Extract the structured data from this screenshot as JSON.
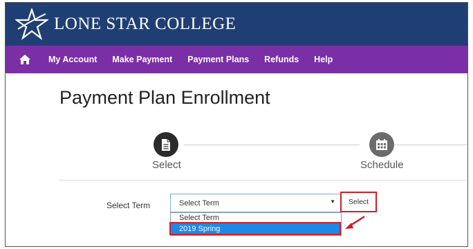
{
  "brand": {
    "name": "LONE STAR COLLEGE"
  },
  "nav": {
    "home_icon": "home-icon",
    "items": [
      {
        "label": "My Account"
      },
      {
        "label": "Make Payment"
      },
      {
        "label": "Payment Plans"
      },
      {
        "label": "Refunds"
      },
      {
        "label": "Help"
      }
    ]
  },
  "page": {
    "title": "Payment Plan Enrollment"
  },
  "steps": [
    {
      "label": "Select",
      "icon": "document-icon",
      "active": true
    },
    {
      "label": "Schedule",
      "icon": "calendar-icon",
      "active": false
    }
  ],
  "form": {
    "term_label": "Select Term",
    "term_value": "Select Term",
    "options": [
      "Select Term",
      "2019 Spring"
    ],
    "selected_option": "2019 Spring",
    "select_button": "Select"
  },
  "colors": {
    "brand_bar": "#1f3f74",
    "nav_bar": "#7a2fa6",
    "highlight": "#cc1f2a",
    "selection": "#1e88e5"
  }
}
